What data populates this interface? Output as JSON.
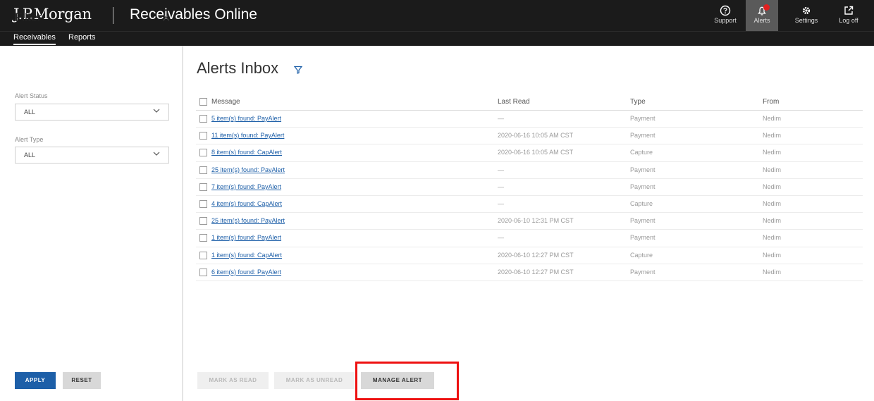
{
  "header": {
    "brand": "J.P.Morgan",
    "app_title": "Receivables Online",
    "tools": [
      {
        "label": "Support",
        "icon": "help-icon"
      },
      {
        "label": "Alerts",
        "icon": "alert-bell-icon"
      },
      {
        "label": "Settings",
        "icon": "gear-icon"
      },
      {
        "label": "Log off",
        "icon": "logoff-icon"
      }
    ]
  },
  "subnav": {
    "items": [
      "Receivables",
      "Reports"
    ]
  },
  "filter": {
    "title": "Filter",
    "close": "×",
    "alert_status": {
      "label": "Alert Status",
      "value": "ALL"
    },
    "alert_type": {
      "label": "Alert Type",
      "value": "ALL"
    },
    "apply_label": "APPLY",
    "reset_label": "RESET"
  },
  "main": {
    "title": "Alerts Inbox",
    "columns": [
      "Message",
      "Last Read",
      "Type",
      "From"
    ],
    "rows": [
      {
        "message": "5 item(s) found: PayAlert",
        "last_read": "—",
        "type": "Payment",
        "from": "Nedim"
      },
      {
        "message": "11 item(s) found: PayAlert",
        "last_read": "2020-06-16 10:05 AM CST",
        "type": "Payment",
        "from": "Nedim"
      },
      {
        "message": "8 item(s) found: CapAlert",
        "last_read": "2020-06-16 10:05 AM CST",
        "type": "Capture",
        "from": "Nedim"
      },
      {
        "message": "25 item(s) found: PayAlert",
        "last_read": "—",
        "type": "Payment",
        "from": "Nedim"
      },
      {
        "message": "7 item(s) found: PayAlert",
        "last_read": "—",
        "type": "Payment",
        "from": "Nedim"
      },
      {
        "message": "4 item(s) found: CapAlert",
        "last_read": "—",
        "type": "Capture",
        "from": "Nedim"
      },
      {
        "message": "25 item(s) found: PayAlert",
        "last_read": "2020-06-10 12:31 PM CST",
        "type": "Payment",
        "from": "Nedim"
      },
      {
        "message": "1 item(s) found: PayAlert",
        "last_read": "—",
        "type": "Payment",
        "from": "Nedim"
      },
      {
        "message": "1 item(s) found: CapAlert",
        "last_read": "2020-06-10 12:27 PM CST",
        "type": "Capture",
        "from": "Nedim"
      },
      {
        "message": "6 item(s) found: PayAlert",
        "last_read": "2020-06-10 12:27 PM CST",
        "type": "Payment",
        "from": "Nedim"
      }
    ],
    "mark_read_label": "MARK AS READ",
    "mark_unread_label": "MARK AS UNREAD",
    "manage_alert_label": "MANAGE ALERT"
  },
  "colors": {
    "topbar": "#1b1b1b",
    "primary": "#1d5fa8",
    "highlight": "#ee1111",
    "badge": "#e02020"
  }
}
